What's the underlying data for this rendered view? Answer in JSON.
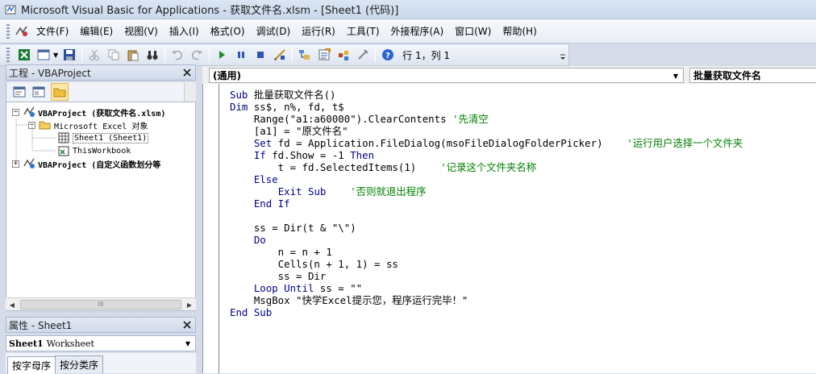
{
  "window": {
    "title": "Microsoft Visual Basic for Applications - 获取文件名.xlsm - [Sheet1 (代码)]"
  },
  "menu": {
    "items": [
      "文件(F)",
      "编辑(E)",
      "视图(V)",
      "插入(I)",
      "格式(O)",
      "调试(D)",
      "运行(R)",
      "工具(T)",
      "外接程序(A)",
      "窗口(W)",
      "帮助(H)"
    ]
  },
  "toolbar": {
    "cursor_position": "行 1，列 1"
  },
  "project_panel": {
    "title": "工程 - VBAProject",
    "tree": {
      "project1": "VBAProject (获取文件名.xlsm)",
      "folder": "Microsoft Excel 对象",
      "sheet1": "Sheet1 (Sheet1)",
      "workbook": "ThisWorkbook",
      "project2": "VBAProject (自定义函数划分等"
    },
    "scroll_thumb": "III"
  },
  "properties_panel": {
    "title": "属性 - Sheet1",
    "object_name": "Sheet1",
    "object_type": "Worksheet",
    "tabs": [
      "按字母序",
      "按分类序"
    ]
  },
  "code_window": {
    "object_combo": "(通用)",
    "procedure_combo": "批量获取文件名",
    "lines": [
      [
        {
          "t": "kw",
          "v": "Sub"
        },
        {
          "t": "tx",
          "v": " 批量获取文件名()"
        }
      ],
      [
        {
          "t": "kw",
          "v": "Dim"
        },
        {
          "t": "tx",
          "v": " ss$, n%, fd, t$"
        }
      ],
      [
        {
          "t": "tx",
          "v": "    Range(\"a1:a60000\").ClearContents "
        },
        {
          "t": "cm",
          "v": "'先清空"
        }
      ],
      [
        {
          "t": "tx",
          "v": "    [a1] = \"原文件名\""
        }
      ],
      [
        {
          "t": "tx",
          "v": "    "
        },
        {
          "t": "kw",
          "v": "Set"
        },
        {
          "t": "tx",
          "v": " fd = Application.FileDialog(msoFileDialogFolderPicker)    "
        },
        {
          "t": "cm",
          "v": "'运行用户选择一个文件夹"
        }
      ],
      [
        {
          "t": "tx",
          "v": "    "
        },
        {
          "t": "kw",
          "v": "If"
        },
        {
          "t": "tx",
          "v": " fd.Show = -1 "
        },
        {
          "t": "kw",
          "v": "Then"
        }
      ],
      [
        {
          "t": "tx",
          "v": "        t = fd.SelectedItems(1)    "
        },
        {
          "t": "cm",
          "v": "'记录这个文件夹名称"
        }
      ],
      [
        {
          "t": "tx",
          "v": "    "
        },
        {
          "t": "kw",
          "v": "Else"
        }
      ],
      [
        {
          "t": "tx",
          "v": "        "
        },
        {
          "t": "kw",
          "v": "Exit Sub"
        },
        {
          "t": "tx",
          "v": "    "
        },
        {
          "t": "cm",
          "v": "'否则就退出程序"
        }
      ],
      [
        {
          "t": "tx",
          "v": "    "
        },
        {
          "t": "kw",
          "v": "End If"
        }
      ],
      [
        {
          "t": "tx",
          "v": ""
        }
      ],
      [
        {
          "t": "tx",
          "v": "    ss = Dir(t & \"\\\")"
        }
      ],
      [
        {
          "t": "tx",
          "v": "    "
        },
        {
          "t": "kw",
          "v": "Do"
        }
      ],
      [
        {
          "t": "tx",
          "v": "        n = n + 1"
        }
      ],
      [
        {
          "t": "tx",
          "v": "        Cells(n + 1, 1) = ss"
        }
      ],
      [
        {
          "t": "tx",
          "v": "        ss = Dir"
        }
      ],
      [
        {
          "t": "tx",
          "v": "    "
        },
        {
          "t": "kw",
          "v": "Loop Until"
        },
        {
          "t": "tx",
          "v": " ss = \"\""
        }
      ],
      [
        {
          "t": "tx",
          "v": "    MsgBox \"快学Excel提示您，程序运行完毕！\""
        }
      ],
      [
        {
          "t": "kw",
          "v": "End Sub"
        }
      ]
    ]
  },
  "colors": {
    "keyword": "#00008b",
    "comment": "#008000",
    "text": "#000000"
  }
}
